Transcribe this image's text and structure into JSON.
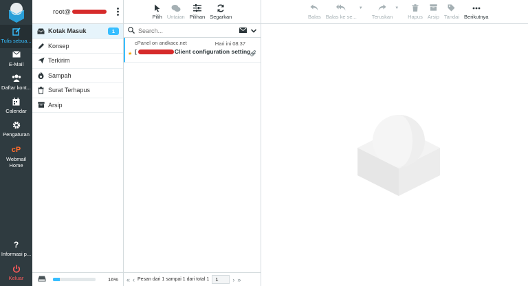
{
  "appnav": {
    "items": [
      {
        "label": "Tulis sebua...",
        "icon": "compose-icon",
        "active": true
      },
      {
        "label": "E-Mail",
        "icon": "envelope-icon"
      },
      {
        "label": "Daftar kont...",
        "icon": "contacts-icon"
      },
      {
        "label": "Calendar",
        "icon": "calendar-icon"
      },
      {
        "label": "Pengaturan",
        "icon": "gear-icon"
      },
      {
        "label": "Webmail Home",
        "icon": "cpanel-icon"
      },
      {
        "label": "Informasi p...",
        "icon": "question-icon"
      },
      {
        "label": "Keluar",
        "icon": "power-icon"
      }
    ]
  },
  "header": {
    "user_label": "root@"
  },
  "folders": [
    {
      "label": "Kotak Masuk",
      "icon": "inbox-icon",
      "badge": "1",
      "selected": true
    },
    {
      "label": "Konsep",
      "icon": "pencil-icon"
    },
    {
      "label": "Terkirim",
      "icon": "paper-plane-icon"
    },
    {
      "label": "Sampah",
      "icon": "fire-icon"
    },
    {
      "label": "Surat Terhapus",
      "icon": "trash-icon"
    },
    {
      "label": "Arsip",
      "icon": "archive-icon"
    }
  ],
  "quota": {
    "percent_text": "16%",
    "fraction": 0.16
  },
  "list_toolbar": {
    "select": "Pilih",
    "threads": "Untaian",
    "options": "Pilihan",
    "refresh": "Segarkan"
  },
  "search": {
    "placeholder": "Search..."
  },
  "messages": [
    {
      "from": "cPanel on andkacc.net",
      "date": "Hari ini 08:37",
      "subject_prefix": "[",
      "subject": "Client configuration setting...",
      "flagged": true,
      "attachment": true
    }
  ],
  "pager": {
    "text": "Pesan dari 1 sampai 1 dari total 1",
    "page": "1"
  },
  "message_toolbar": {
    "reply": "Balas",
    "reply_all": "Balas ke se...",
    "forward": "Teruskan",
    "delete": "Hapus",
    "archive": "Arsip",
    "mark": "Tandai",
    "more": "Berikutnya"
  },
  "colors": {
    "accent": "#37beff",
    "nav_bg": "#2f3b40",
    "logout": "#ff5b5b"
  }
}
